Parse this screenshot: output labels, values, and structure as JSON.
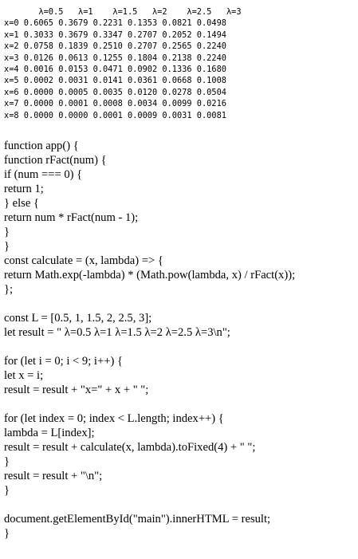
{
  "output_table": {
    "header": "       λ=0.5   λ=1    λ=1.5   λ=2    λ=2.5   λ=3",
    "rows": [
      "x=0 0.6065 0.3679 0.2231 0.1353 0.0821 0.0498",
      "x=1 0.3033 0.3679 0.3347 0.2707 0.2052 0.1494",
      "x=2 0.0758 0.1839 0.2510 0.2707 0.2565 0.2240",
      "x=3 0.0126 0.0613 0.1255 0.1804 0.2138 0.2240",
      "x=4 0.0016 0.0153 0.0471 0.0902 0.1336 0.1680",
      "x=5 0.0002 0.0031 0.0141 0.0361 0.0668 0.1008",
      "x=6 0.0000 0.0005 0.0035 0.0120 0.0278 0.0504",
      "x=7 0.0000 0.0001 0.0008 0.0034 0.0099 0.0216",
      "x=8 0.0000 0.0000 0.0001 0.0009 0.0031 0.0081"
    ]
  },
  "source_code": {
    "lines": [
      "function app() {",
      "function rFact(num) {",
      "if (num === 0) {",
      "return 1;",
      "} else {",
      "return num * rFact(num - 1);",
      "}",
      "}",
      "const calculate = (x, lambda) => {",
      "return Math.exp(-lambda) * (Math.pow(lambda, x) / rFact(x));",
      "};",
      "",
      "const L = [0.5, 1, 1.5, 2, 2.5, 3];",
      "let result = \" λ=0.5 λ=1 λ=1.5 λ=2 λ=2.5 λ=3\\n\";",
      "",
      "for (let i = 0; i < 9; i++) {",
      "let x = i;",
      "result = result + \"x=\" + x + \" \";",
      "",
      "for (let index = 0; index < L.length; index++) {",
      "lambda = L[index];",
      "result = result + calculate(x, lambda).toFixed(4) + \" \";",
      "}",
      "result = result + \"\\n\";",
      "}",
      "",
      "document.getElementById(\"main\").innerHTML = result;",
      "}"
    ]
  }
}
